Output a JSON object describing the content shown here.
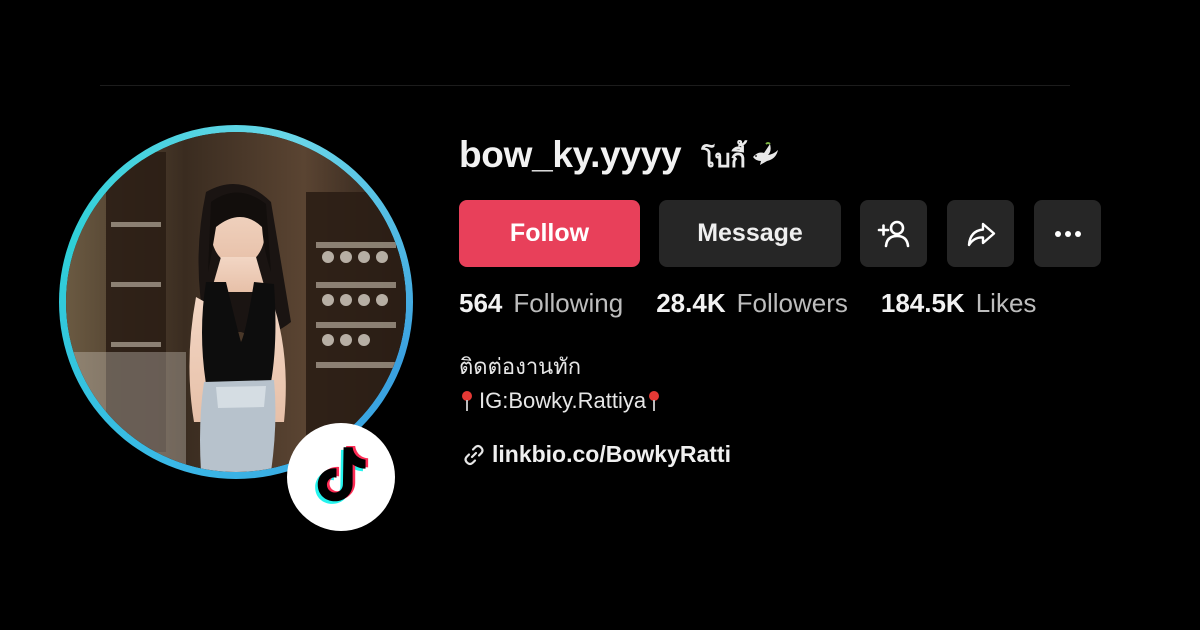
{
  "profile": {
    "username": "bow_ky.yyyy",
    "nickname": "โบกี้",
    "nickname_emoji": "dove-icon"
  },
  "actions": {
    "follow_label": "Follow",
    "message_label": "Message",
    "add_friend_icon": "add-person-icon",
    "share_icon": "share-arrow-icon",
    "more_icon": "ellipsis-icon"
  },
  "stats": {
    "following": {
      "value": "564",
      "label": "Following"
    },
    "followers": {
      "value": "28.4K",
      "label": "Followers"
    },
    "likes": {
      "value": "184.5K",
      "label": "Likes"
    }
  },
  "bio": {
    "line1": "ติดต่องานทัก",
    "line2": "IG:Bowky.Rattiya",
    "line2_emoji": "pin-icon"
  },
  "link": {
    "text": "linkbio.co/BowkyRatti",
    "icon": "link-icon"
  },
  "colors": {
    "background": "#000000",
    "follow": "#e8405a",
    "secondary_button": "#262626",
    "ring": "#3ab7e6"
  }
}
